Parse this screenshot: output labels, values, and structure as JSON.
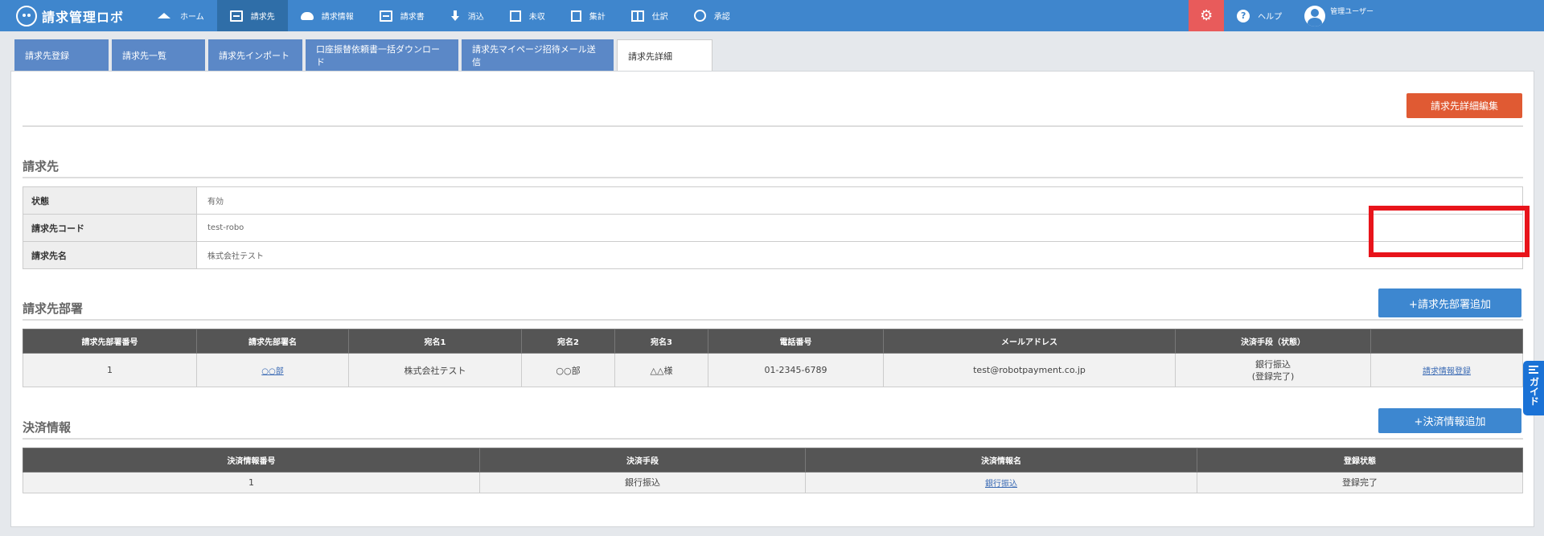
{
  "app": {
    "logo_text": "請求管理ロボ"
  },
  "nav": [
    {
      "label": "ホーム",
      "icon": "home-icon"
    },
    {
      "label": "請求先",
      "icon": "building-icon",
      "active": true
    },
    {
      "label": "請求情報",
      "icon": "cloud-icon"
    },
    {
      "label": "請求書",
      "icon": "list-icon"
    },
    {
      "label": "消込",
      "icon": "download-icon"
    },
    {
      "label": "未収",
      "icon": "checkbox-icon"
    },
    {
      "label": "集計",
      "icon": "calculator-icon"
    },
    {
      "label": "仕訳",
      "icon": "columns-icon"
    },
    {
      "label": "承認",
      "icon": "check-circle-icon"
    }
  ],
  "header": {
    "help_label": "ヘルプ",
    "user_label": "管理ユーザー",
    "help_glyph": "?",
    "gear_glyph": "⚙"
  },
  "tabs": [
    {
      "label": "請求先登録"
    },
    {
      "label": "請求先一覧"
    },
    {
      "label": "請求先インポート"
    },
    {
      "label": "口座振替依頼書一括ダウンロード"
    },
    {
      "label": "請求先マイページ招待メール送信"
    },
    {
      "label": "請求先詳細",
      "active": true
    }
  ],
  "actions": {
    "edit_label": "請求先詳細編集",
    "add_dept_label": "+請求先部署追加",
    "add_payment_label": "+決済情報追加"
  },
  "billing": {
    "title": "請求先",
    "rows": [
      {
        "key": "状態",
        "value": "有効"
      },
      {
        "key": "請求先コード",
        "value": "test-robo"
      },
      {
        "key": "請求先名",
        "value": "株式会社テスト"
      }
    ]
  },
  "departments": {
    "title": "請求先部署",
    "headers": [
      "請求先部署番号",
      "請求先部署名",
      "宛名1",
      "宛名2",
      "宛名3",
      "電話番号",
      "メールアドレス",
      "決済手段（状態）",
      ""
    ],
    "row": {
      "number": "1",
      "name": "○○部",
      "addr1": "株式会社テスト",
      "addr2": "○○部",
      "addr3": "△△様",
      "phone": "01-2345-6789",
      "email": "test@robotpayment.co.jp",
      "payment_line1": "銀行振込",
      "payment_line2": "(登録完了)",
      "action": "請求情報登録"
    }
  },
  "payment": {
    "title": "決済情報",
    "headers": [
      "決済情報番号",
      "決済手段",
      "決済情報名",
      "登録状態"
    ],
    "row": {
      "number": "1",
      "method": "銀行振込",
      "name": "銀行振込",
      "status": "登録完了"
    }
  },
  "guide": {
    "label": "ガイド"
  },
  "colors": {
    "header": "#3f86cd",
    "accent_red": "#e05a33",
    "button_blue": "#3d87d0",
    "highlight": "#e8141b"
  }
}
